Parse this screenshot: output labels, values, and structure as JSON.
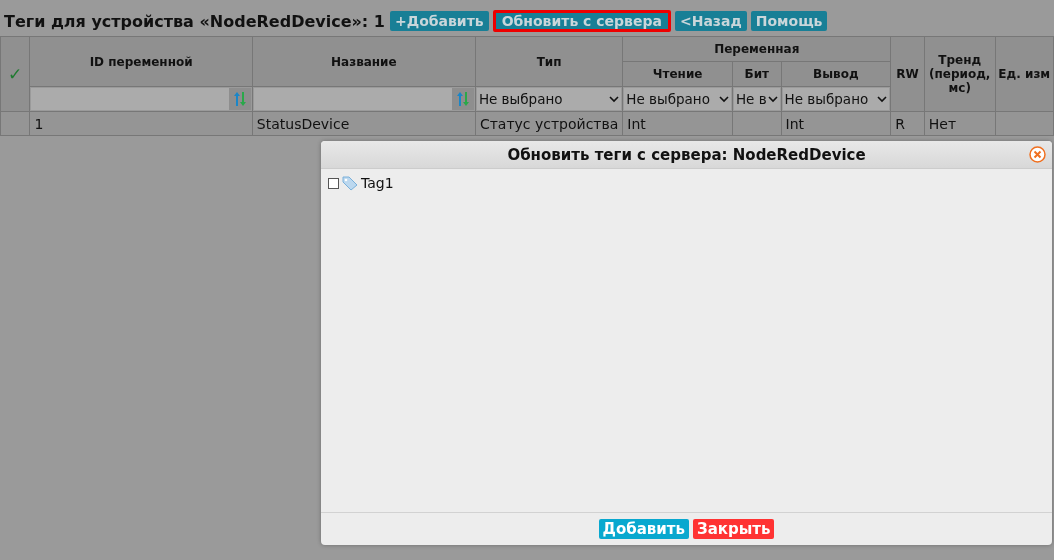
{
  "header": {
    "title": "Теги для устройства «NodeRedDevice»: 1",
    "buttons": [
      {
        "label": "+Добавить",
        "highlighted": false
      },
      {
        "label": "Обновить с сервера",
        "highlighted": true
      },
      {
        "label": "<Назад",
        "highlighted": false
      },
      {
        "label": "Помощь",
        "highlighted": false
      }
    ]
  },
  "table": {
    "check_mark": "✓",
    "columns": [
      {
        "label": "ID переменной",
        "filter": {
          "kind": "text"
        }
      },
      {
        "label": "Название",
        "filter": {
          "kind": "text"
        }
      },
      {
        "label": "Тип",
        "filter": {
          "kind": "select",
          "value": "Не выбрано"
        }
      },
      {
        "group": "Переменная",
        "colspan": 3,
        "columns": [
          {
            "label": "Чтение",
            "filter": {
              "kind": "select",
              "value": "Не выбрано"
            }
          },
          {
            "label": "Бит",
            "filter": {
              "kind": "select",
              "value": "Не в"
            }
          },
          {
            "label": "Вывод",
            "filter": {
              "kind": "select",
              "value": "Не выбрано"
            }
          }
        ]
      },
      {
        "label": "RW"
      },
      {
        "label": "Тренд (период, мс)"
      },
      {
        "label": "Ед. изм"
      }
    ],
    "rows": [
      {
        "cells": [
          "1",
          "StatusDevice",
          "Статус устройства",
          "Int",
          "",
          "Int",
          "R",
          "Нет",
          ""
        ]
      }
    ]
  },
  "dialog": {
    "title": "Обновить теги с сервера: NodeRedDevice",
    "tree": [
      {
        "label": "Tag1",
        "checked": false
      }
    ],
    "buttons": [
      {
        "label": "Добавить",
        "kind": "primary"
      },
      {
        "label": "Закрыть",
        "kind": "danger"
      }
    ]
  }
}
